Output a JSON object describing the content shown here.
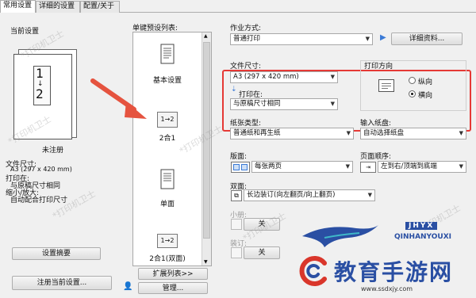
{
  "tabs": [
    "常用设置",
    "详细的设置",
    "配置/关于"
  ],
  "current": {
    "title": "当前设置",
    "unregistered": "未注册",
    "info": [
      "文件尺寸:",
      "A3 (297 x 420 mm)",
      "打印在:",
      "与原稿尺寸相同",
      "缩小/放大:",
      "自动配合打印尺寸"
    ],
    "preview_numbers": [
      "1",
      "2"
    ],
    "settings_summary_button": "设置摘要",
    "register_button": "注册当前设置..."
  },
  "presets": {
    "title": "单键预设列表:",
    "items": [
      {
        "label": "基本设置"
      },
      {
        "label": "2合1",
        "icon_text": "1→2"
      },
      {
        "label": "单面"
      },
      {
        "label": "2合1(双面)",
        "icon_text": "1→2"
      }
    ],
    "expand_button": "扩展列表>>",
    "manage_button": "管理..."
  },
  "job": {
    "label": "作业方式:",
    "value": "普通打印",
    "details_button": "详细资料..."
  },
  "paper": {
    "size_label": "文件尺寸:",
    "size_value": "A3 (297 x 420 mm)",
    "print_on_label": "打印在:",
    "print_on_value": "与原稿尺寸相同",
    "orientation_label": "打印方向",
    "portrait": "纵向",
    "landscape": "横向",
    "selected": "landscape"
  },
  "media": {
    "type_label": "纸张类型:",
    "type_value": "普通纸和再生纸",
    "source_label": "输入纸盘:",
    "source_value": "自动选择纸盘"
  },
  "layout": {
    "label": "版面:",
    "value": "每张两页",
    "order_label": "页面顺序:",
    "order_value": "左到右/顶端到底端"
  },
  "duplex": {
    "label": "双面:",
    "value": "长边装订(向左翻页/向上翻页)"
  },
  "booklet": {
    "label": "小册:",
    "value": "关"
  },
  "staple": {
    "label": "装订:",
    "value": "关"
  },
  "watermarks": {
    "cn": "*打印机卫士",
    "overlay_brand": "QINHANYOUXI",
    "overlay_brand_mark": "JHYX",
    "overlay_cn": "教育手游网",
    "overlay_url": "www.ssdxjy.com"
  },
  "colors": {
    "highlight": "#e53935",
    "arrow": "#e5533f",
    "logo_blue": "#2a4fa3",
    "logo_red": "#d9362b",
    "selection": "#0063c6"
  }
}
